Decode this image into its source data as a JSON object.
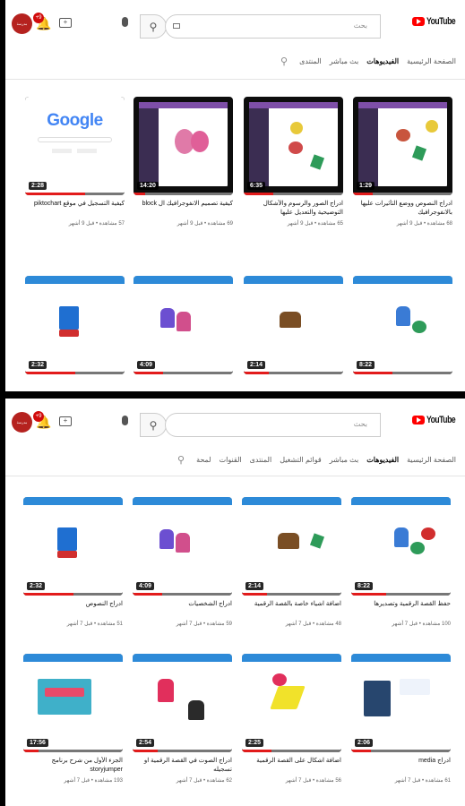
{
  "colors": {
    "brand_red": "#ff0000",
    "progress_red": "#e21b1b",
    "avatar": "#b5221f"
  },
  "header": {
    "brand": "YouTube",
    "search_placeholder": "بحث",
    "notifications_badge": "+9",
    "avatar_text": "مدرسة"
  },
  "top": {
    "tabs": [
      "الصفحة الرئيسية",
      "الفيديوهات",
      "بث مباشر",
      "المنتدى"
    ],
    "active_tab": 1,
    "videos_row1": [
      {
        "title": "ادراج النصوص ووضع التأثيرات عليها بالانفوجرافيك",
        "meta": "68 مشاهدة • قبل 9 أشهر",
        "duration": "1:29"
      },
      {
        "title": "ادراج الصور والرسوم والأشكال التوضيحية والتعديل عليها",
        "meta": "65 مشاهدة • قبل 9 أشهر",
        "duration": "6:35"
      },
      {
        "title": "كيفية تصميم الانفوجرافيك ال block",
        "meta": "69 مشاهدة • قبل 9 أشهر",
        "duration": "14:20"
      },
      {
        "title": "كيفية التسجيل في موقع piktochart",
        "meta": "57 مشاهدة • قبل 9 أشهر",
        "duration": "2:28",
        "google_text": "Google"
      }
    ],
    "videos_row2_durations": [
      "8:22",
      "2:14",
      "4:09",
      "2:32"
    ]
  },
  "bottom": {
    "tabs": [
      "الصفحة الرئيسية",
      "الفيديوهات",
      "بث مباشر",
      "قوائم التشغيل",
      "المنتدى",
      "القنوات",
      "لمحة"
    ],
    "active_tab": 1,
    "videos_row1": [
      {
        "title": "حفظ القصة الرقمية وتصديرها",
        "meta": "100 مشاهدة • قبل 7 أشهر",
        "duration": "8:22"
      },
      {
        "title": "اضافة اشياء خاصة بالقصة الرقمية",
        "meta": "48 مشاهدة • قبل 7 أشهر",
        "duration": "2:14"
      },
      {
        "title": "ادراج الشخصيات",
        "meta": "59 مشاهدة • قبل 7 أشهر",
        "duration": "4:09"
      },
      {
        "title": "ادراج النصوص",
        "meta": "51 مشاهدة • قبل 7 أشهر",
        "duration": "2:32"
      }
    ],
    "videos_row2": [
      {
        "title": "ادراج media",
        "meta": "61 مشاهدة • قبل 7 أشهر",
        "duration": "2:06"
      },
      {
        "title": "اضافة اشكال على القصة الرقمية",
        "meta": "56 مشاهدة • قبل 7 أشهر",
        "duration": "2:25"
      },
      {
        "title": "ادراج الصوت في القصة الرقمية او تسجيله",
        "meta": "62 مشاهدة • قبل 7 أشهر",
        "duration": "2:54"
      },
      {
        "title": "الجزء الأول من شرح برنامج storyjumper",
        "meta": "193 مشاهدة • قبل 7 أشهر",
        "duration": "17:56"
      }
    ]
  }
}
